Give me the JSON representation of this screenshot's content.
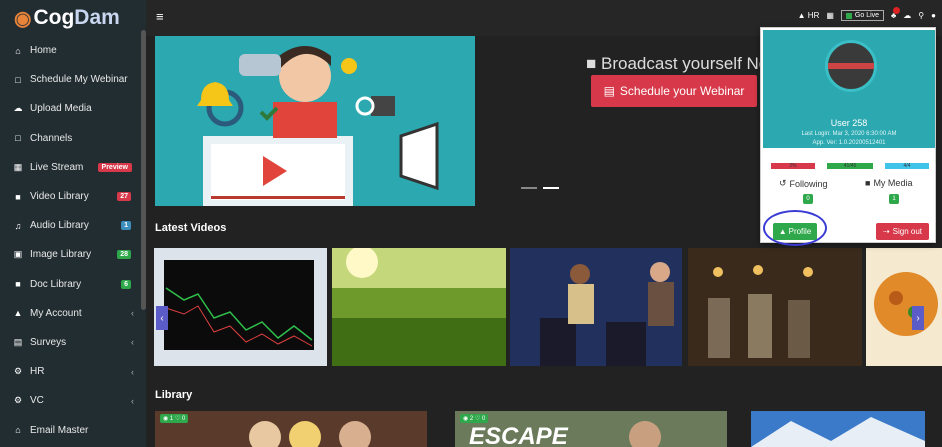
{
  "brand": {
    "name_part1": "Cog",
    "name_part2": "Dam"
  },
  "sidebar": {
    "items": [
      {
        "label": "Home",
        "icon": "home-icon",
        "glyph": "⌂"
      },
      {
        "label": "Schedule My Webinar",
        "icon": "calendar-icon",
        "glyph": "□"
      },
      {
        "label": "Upload Media",
        "icon": "cloud-upload-icon",
        "glyph": "☁"
      },
      {
        "label": "Channels",
        "icon": "channel-icon",
        "glyph": "□"
      },
      {
        "label": "Live Stream",
        "icon": "calendar-icon",
        "glyph": "▦",
        "badge": "Preview",
        "badge_color": "#d8394a"
      },
      {
        "label": "Video Library",
        "icon": "video-camera-icon",
        "glyph": "■",
        "badge": "27",
        "badge_color": "#d8394a"
      },
      {
        "label": "Audio Library",
        "icon": "music-icon",
        "glyph": "♫",
        "badge": "1",
        "badge_color": "#3c8dbc"
      },
      {
        "label": "Image Library",
        "icon": "image-icon",
        "glyph": "▣",
        "badge": "28",
        "badge_color": "#2ea84a"
      },
      {
        "label": "Doc Library",
        "icon": "document-icon",
        "glyph": "■",
        "badge": "6",
        "badge_color": "#2ea84a"
      },
      {
        "label": "My Account",
        "icon": "user-icon",
        "glyph": "▲",
        "chevron": "‹"
      },
      {
        "label": "Surveys",
        "icon": "lock-icon",
        "glyph": "▤",
        "chevron": "‹"
      },
      {
        "label": "HR",
        "icon": "gears-icon",
        "glyph": "⚙",
        "chevron": "‹"
      },
      {
        "label": "VC",
        "icon": "gears-icon",
        "glyph": "⚙",
        "chevron": "‹"
      },
      {
        "label": "Email Master",
        "icon": "home-icon",
        "glyph": "⌂"
      }
    ]
  },
  "topbar": {
    "hamburger": "≡",
    "hr_label": "HR",
    "go_live_label": "Go Live",
    "icons": {
      "hr": "graduation-cap-icon",
      "calendar": "calendar-icon",
      "bell": "bell-icon",
      "cloud": "cloud-upload-icon",
      "search": "search-icon",
      "user": "user-icon"
    }
  },
  "hero": {
    "title": "Broadcast yourself No",
    "schedule_button": "Schedule your Webinar"
  },
  "latest_videos": {
    "title": "Latest Videos"
  },
  "library": {
    "title": "Library",
    "items": [
      {
        "badge": "◉ 1 ♡ 0"
      },
      {
        "badge": "◉ 2 ♡ 0",
        "overlay_text": "ESCAPE"
      },
      {
        "badge": ""
      }
    ]
  },
  "user_dropdown": {
    "name": "User 258",
    "last_login": "Last Login: Mar 3, 2020 6:30:00 AM",
    "app_version": "App. Ver: 1.0.20200512401",
    "stats": [
      "2%",
      "41/45",
      "4/4"
    ],
    "following_label": "Following",
    "following_count": "0",
    "my_media_label": "My Media",
    "my_media_count": "1",
    "profile_button": "Profile",
    "signout_button": "Sign out"
  },
  "colors": {
    "accent_red": "#d8394a",
    "accent_green": "#2ea84a",
    "teal": "#2ba8b0",
    "sidebar_bg": "#222d32"
  }
}
